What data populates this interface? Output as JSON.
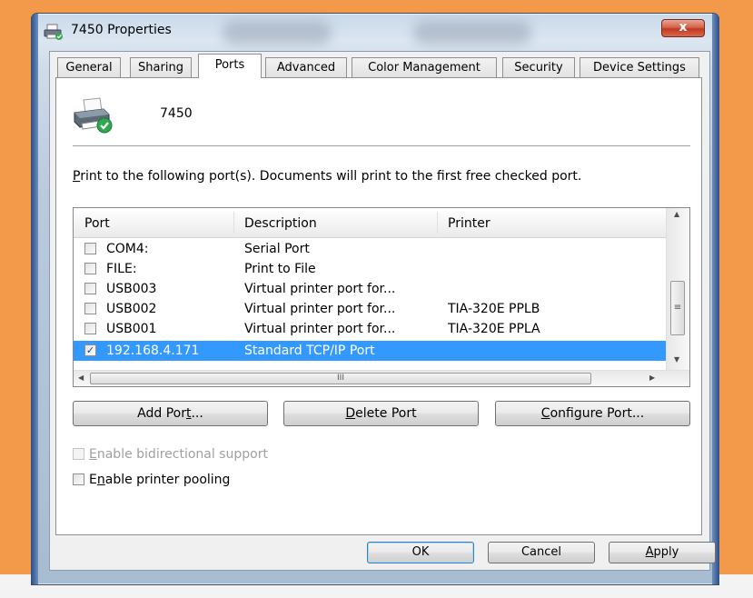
{
  "window": {
    "title": "7450 Properties",
    "close_glyph": "x",
    "accent": "#f39a4a"
  },
  "tabs": [
    {
      "label": "General",
      "active": false
    },
    {
      "label": "Sharing",
      "active": false
    },
    {
      "label": "Ports",
      "active": true
    },
    {
      "label": "Advanced",
      "active": false
    },
    {
      "label": "Color Management",
      "active": false
    },
    {
      "label": "Security",
      "active": false
    },
    {
      "label": "Device Settings",
      "active": false
    }
  ],
  "printer": {
    "name": "7450",
    "icon": "printer-icon"
  },
  "ports_page": {
    "info_prefix": "P",
    "info_rest": "rint to the following port(s). Documents will print to the first free checked port.",
    "columns": [
      "Port",
      "Description",
      "Printer"
    ],
    "rows": [
      {
        "port": "COM4:",
        "description": "Serial Port",
        "printer": "",
        "checked": false,
        "selected": false
      },
      {
        "port": "FILE:",
        "description": "Print to File",
        "printer": "",
        "checked": false,
        "selected": false
      },
      {
        "port": "USB003",
        "description": "Virtual printer port for...",
        "printer": "",
        "checked": false,
        "selected": false
      },
      {
        "port": "USB002",
        "description": "Virtual printer port for...",
        "printer": "TIA-320E PPLB",
        "checked": false,
        "selected": false
      },
      {
        "port": "USB001",
        "description": "Virtual printer port for...",
        "printer": "TIA-320E PPLA",
        "checked": false,
        "selected": false
      },
      {
        "port": "192.168.4.171",
        "description": "Standard TCP/IP Port",
        "printer": "",
        "checked": true,
        "selected": true
      }
    ],
    "selection_color": "#3399ff",
    "buttons": {
      "add_port_a": "Add Por",
      "add_port_u": "t",
      "add_port_b": "...",
      "delete_port_u": "D",
      "delete_port_b": "elete Port",
      "configure_port_u": "C",
      "configure_port_b": "onfigure Port..."
    },
    "bidirectional_u": "E",
    "bidirectional_b": "nable bidirectional support",
    "bidirectional_enabled": false,
    "pooling_a": "E",
    "pooling_u": "n",
    "pooling_b": "able printer pooling",
    "pooling_checked": false
  },
  "dialog_buttons": {
    "ok": "OK",
    "cancel": "Cancel",
    "apply_u": "A",
    "apply_b": "pply"
  }
}
